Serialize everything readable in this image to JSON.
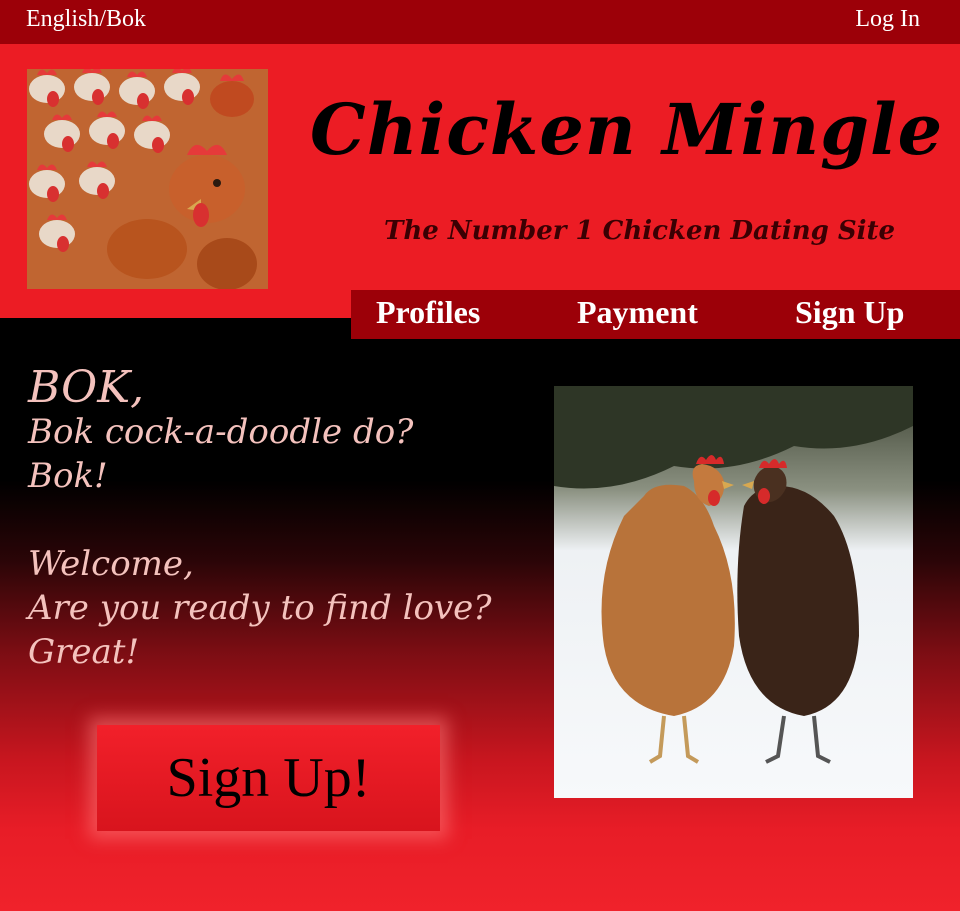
{
  "topbar": {
    "language_label": "English/Bok",
    "login_label": "Log In"
  },
  "header": {
    "title": "Chicken Mingle",
    "tagline": "The Number 1 Chicken Dating Site"
  },
  "nav": {
    "items": [
      {
        "label": "Profiles"
      },
      {
        "label": "Payment"
      },
      {
        "label": "Sign Up"
      }
    ]
  },
  "welcome": {
    "lines_top": [
      "BOK,",
      "Bok cock-a-doodle do?",
      "Bok!"
    ],
    "lines_bottom": [
      "Welcome,",
      "Are you ready to find love?",
      "Great!"
    ]
  },
  "cta": {
    "label": "Sign Up!"
  },
  "images": {
    "logo": "flock-of-chickens-image",
    "photo": "two-chickens-in-snow-image"
  },
  "colors": {
    "header_red": "#ec1c24",
    "bar_dark_red": "#9c0008",
    "welcome_text": "#f4c2bd",
    "background_dark": "#000000"
  }
}
